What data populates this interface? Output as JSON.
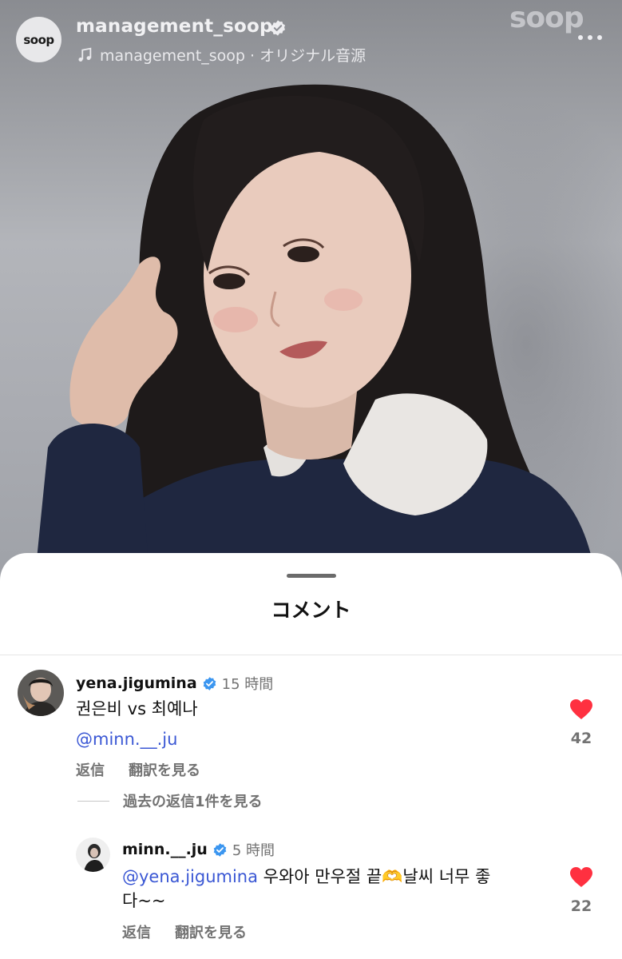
{
  "post": {
    "account_name": "management_soop",
    "audio_label": "management_soop · オリジナル音源",
    "watermark": "soop",
    "avatar_logo_text": "soop"
  },
  "sheet": {
    "title": "コメント"
  },
  "comments": [
    {
      "username": "yena.jigumina",
      "time": "15 時間",
      "text_line1": "권은비 vs 최예나",
      "text_mention": "@minn.__.ju",
      "reply_label": "返信",
      "translate_label": "翻訳を見る",
      "likes": "42",
      "view_replies": "過去の返信1件を見る"
    },
    {
      "username": "minn.__.ju",
      "time": "5 時間",
      "text_mention": "@yena.jigumina",
      "text_body_1": " 우와아 만우절 끝🫶날씨 너무 좋",
      "text_body_2": "다~~",
      "reply_label": "返信",
      "translate_label": "翻訳を見る",
      "likes": "22"
    }
  ],
  "colors": {
    "heart": "#ff3040",
    "mention": "#3a57d4",
    "verified": "#3b96f0",
    "meta_text": "#737373"
  },
  "icons": [
    "verified-badge-icon",
    "music-note-icon",
    "more-options-icon",
    "heart-icon"
  ]
}
